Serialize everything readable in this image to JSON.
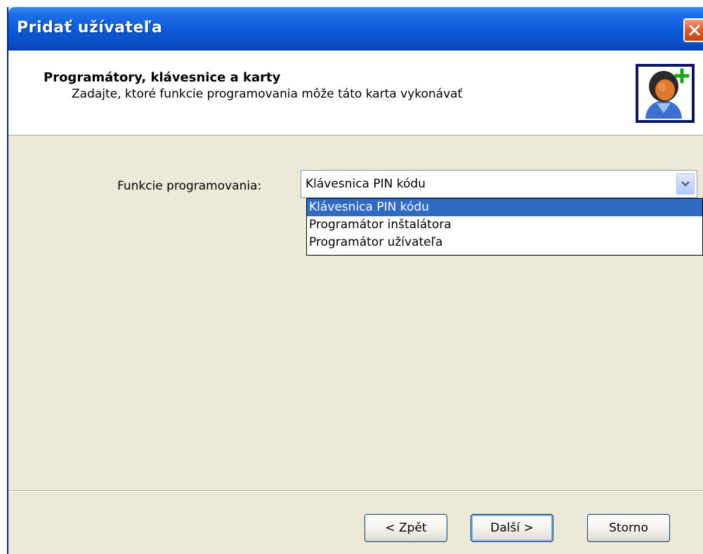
{
  "window": {
    "title": "Pridať užívateľa"
  },
  "header": {
    "title": "Programátory, klávesnice a karty",
    "subtitle": "Zadajte, ktoré funkcie programovania môže táto karta vykonávať"
  },
  "form": {
    "programming_function": {
      "label": "Funkcie programovania:",
      "selected_value": "Klávesnica PIN kódu",
      "options": [
        "Klávesnica PIN kódu",
        "Programátor inštalátora",
        "Programátor užívateľa"
      ],
      "highlighted_index": 0
    }
  },
  "buttons": {
    "back": "< Zpět",
    "next": "Další >",
    "cancel": "Storno"
  },
  "icons": {
    "close": "close-icon",
    "avatar": "add-user-icon",
    "dropdown": "chevron-down-icon"
  },
  "colors": {
    "titlebar": "#0a5ad8",
    "dialog_bg": "#ece9d8",
    "selection": "#316ac5",
    "close_button": "#e35b2c"
  }
}
